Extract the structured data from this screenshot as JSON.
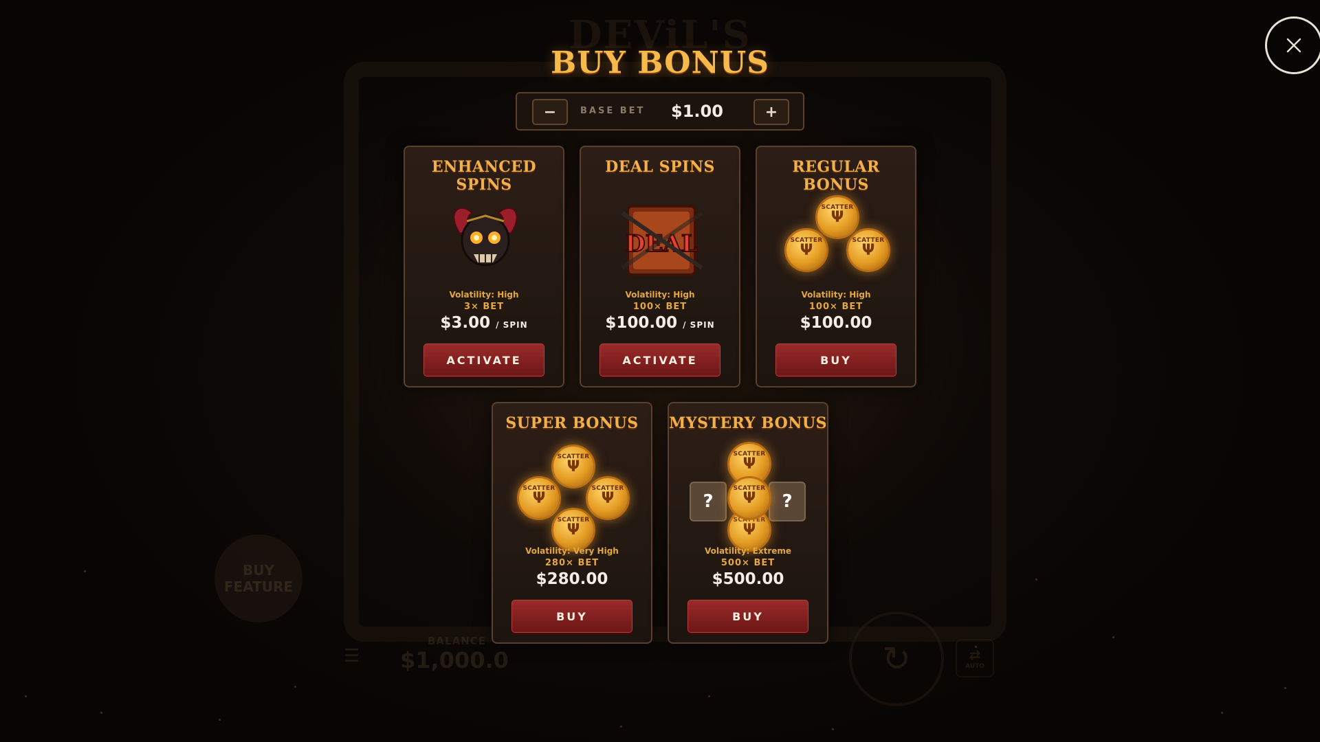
{
  "background": {
    "game_logo": "DEViL'S",
    "buy_feature": "BUY FEATURE",
    "balance_label": "BALANCE",
    "balance_value": "$1,000.0",
    "auto_label": "AUTO"
  },
  "modal": {
    "title": "BUY BONUS",
    "close_icon": "close-icon",
    "bet": {
      "minus": "−",
      "plus": "+",
      "label": "BASE BET",
      "value": "$1.00"
    },
    "cards": [
      {
        "title": "ENHANCED SPINS",
        "art": "devil-skull-icon",
        "volatility": "Volatility: High",
        "multiplier": "3× BET",
        "price": "$3.00",
        "unit": "/ SPIN",
        "button": "ACTIVATE"
      },
      {
        "title": "DEAL SPINS",
        "art": "deal-sign-icon",
        "volatility": "Volatility: High",
        "multiplier": "100× BET",
        "price": "$100.00",
        "unit": "/ SPIN",
        "button": "ACTIVATE"
      },
      {
        "title": "REGULAR BONUS",
        "art": "scatter-coins-3",
        "volatility": "Volatility: High",
        "multiplier": "100× BET",
        "price": "$100.00",
        "unit": "",
        "button": "BUY"
      },
      {
        "title": "SUPER BONUS",
        "art": "scatter-coins-4",
        "volatility": "Volatility: Very High",
        "multiplier": "280× BET",
        "price": "$280.00",
        "unit": "",
        "button": "BUY"
      },
      {
        "title": "MYSTERY BONUS",
        "art": "scatter-coins-mystery",
        "volatility": "Volatility: Extreme",
        "multiplier": "500× BET",
        "price": "$500.00",
        "unit": "",
        "button": "BUY"
      }
    ],
    "scatter_label": "SCATTER",
    "mystery_mark": "?"
  },
  "colors": {
    "title": "#f6b94c",
    "accent": "#e3a83f",
    "button": "#8a2222"
  }
}
